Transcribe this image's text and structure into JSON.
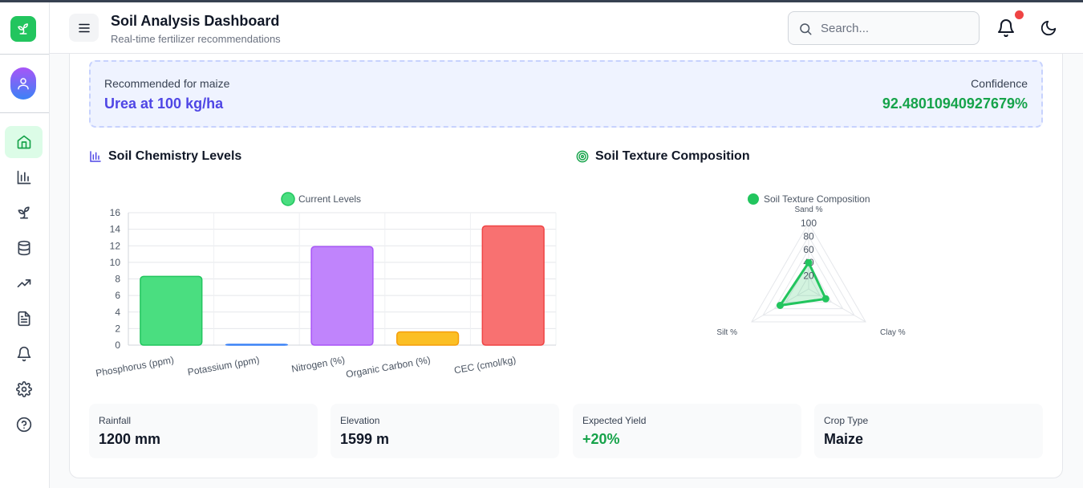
{
  "header": {
    "title": "Soil Analysis Dashboard",
    "subtitle": "Real-time fertilizer recommendations",
    "search_placeholder": "Search..."
  },
  "sidebar": {
    "items": [
      {
        "name": "home-icon",
        "active": true
      },
      {
        "name": "bar-chart-icon"
      },
      {
        "name": "sprout-icon"
      },
      {
        "name": "database-icon"
      },
      {
        "name": "trending-up-icon"
      },
      {
        "name": "file-text-icon"
      },
      {
        "name": "bell-icon"
      },
      {
        "name": "settings-icon"
      },
      {
        "name": "help-circle-icon"
      }
    ]
  },
  "recommendation": {
    "label": "Recommended for maize",
    "value": "Urea at 100 kg/ha",
    "confidence_label": "Confidence",
    "confidence_value": "92.48010940927679%"
  },
  "sections": {
    "chemistry_title": "Soil Chemistry Levels",
    "texture_title": "Soil Texture Composition"
  },
  "stats": [
    {
      "label": "Rainfall",
      "value": "1200 mm"
    },
    {
      "label": "Elevation",
      "value": "1599 m"
    },
    {
      "label": "Expected Yield",
      "value": "+20%"
    },
    {
      "label": "Crop Type",
      "value": "Maize"
    }
  ],
  "colors": {
    "accent": "#4f46e5",
    "success": "#16a34a",
    "brand": "#22c55e"
  },
  "chart_data": [
    {
      "type": "bar",
      "legend": "Current Levels",
      "categories": [
        "Phosphorus (ppm)",
        "Potassium (ppm)",
        "Nitrogen (%)",
        "Organic Carbon (%)",
        "CEC (cmol/kg)"
      ],
      "values": [
        8.3,
        0.1,
        11.9,
        1.6,
        14.4
      ],
      "colors": [
        "#4ade80",
        "#60a5fa",
        "#c084fc",
        "#fbbf24",
        "#f87171"
      ],
      "borders": [
        "#22c55e",
        "#3b82f6",
        "#a855f7",
        "#f59e0b",
        "#ef4444"
      ],
      "ylim": [
        0,
        16
      ],
      "yticks": [
        0,
        2,
        4,
        6,
        8,
        10,
        12,
        14,
        16
      ],
      "grid": true,
      "legend_position": "top"
    },
    {
      "type": "radar",
      "legend": "Soil Texture Composition",
      "axes": [
        "Sand %",
        "Clay %",
        "Silt %"
      ],
      "values": [
        40,
        30,
        50
      ],
      "rlim": [
        0,
        100
      ],
      "rticks": [
        "20",
        "40",
        "60",
        "80",
        "100"
      ],
      "color": "#22c55e",
      "legend_position": "top"
    }
  ]
}
